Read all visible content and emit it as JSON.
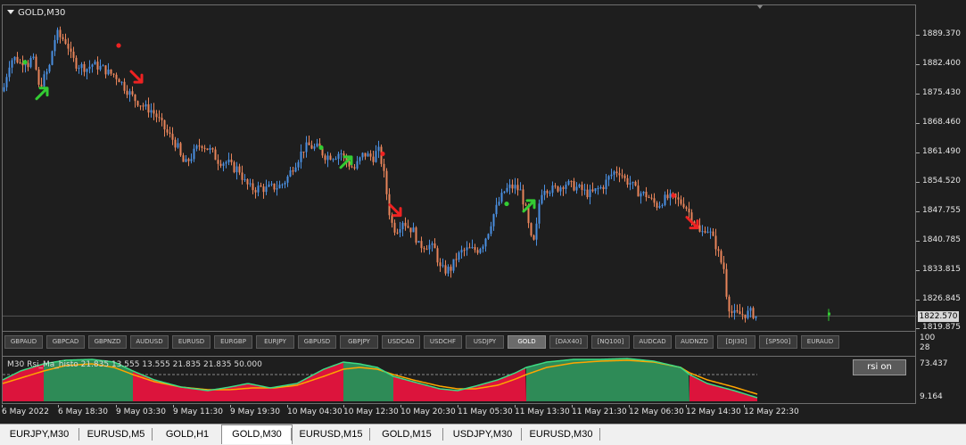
{
  "window": {
    "title": "GOLD,M30"
  },
  "price_axis": [
    "1889.370",
    "1882.400",
    "1875.430",
    "1868.460",
    "1861.490",
    "1854.520",
    "1847.755",
    "1840.785",
    "1833.815",
    "1826.845",
    "1819.875"
  ],
  "current_price": "1822.570",
  "symbols": [
    "GBPAUD",
    "GBPCAD",
    "GBPNZD",
    "AUDUSD",
    "EURUSD",
    "EURGBP",
    "EURJPY",
    "GBPUSD",
    "GBPJPY",
    "USDCAD",
    "USDCHF",
    "USDJPY",
    "GOLD",
    "[DAX40]",
    "[NQ100]",
    "AUDCAD",
    "AUDNZD",
    "[DJI30]",
    "[SP500]",
    "EURAUD"
  ],
  "active_symbol": "GOLD",
  "symbol_axis": [
    "100",
    "28"
  ],
  "indicator": {
    "title": "M30 Rsi_Ma_histo 21.835 13.555 13.555 21.835 21.835 50.000",
    "axis": [
      "73.437",
      "9.164"
    ],
    "button_label": "rsi on"
  },
  "time_axis": [
    "6 May 2022",
    "6 May 18:30",
    "9 May 03:30",
    "9 May 11:30",
    "9 May 19:30",
    "10 May 04:30",
    "10 May 12:30",
    "10 May 20:30",
    "11 May 05:30",
    "11 May 13:30",
    "11 May 21:30",
    "12 May 06:30",
    "12 May 14:30",
    "12 May 22:30"
  ],
  "tabs": [
    "EURJPY,M30",
    "EURUSD,M5",
    "GOLD,H1",
    "GOLD,M30",
    "EURUSD,M15",
    "GOLD,M15",
    "USDJPY,M30",
    "EURUSD,M30"
  ],
  "active_tab": "GOLD,M30",
  "colors": {
    "background": "#1e1e1e",
    "bull": "#4a8fe0",
    "bear": "#e8845a",
    "up_signal": "#33cc33",
    "down_signal": "#ee2222",
    "hist_green": "#2e8b57",
    "hist_red": "#dc143c",
    "rsi_line": "#3ddc84",
    "ma_line": "#ffa500"
  },
  "chart_data": {
    "type": "candlestick",
    "symbol": "GOLD",
    "timeframe": "M30",
    "ylim": [
      1819.875,
      1892.0
    ],
    "close_path": [
      [
        0,
        1876.5
      ],
      [
        4,
        1880.5
      ],
      [
        8,
        1884.0
      ],
      [
        14,
        1884.5
      ],
      [
        20,
        1883.0
      ],
      [
        24,
        1884.5
      ],
      [
        28,
        1883.0
      ],
      [
        32,
        1884.5
      ],
      [
        36,
        1883.0
      ],
      [
        40,
        1877.5
      ],
      [
        44,
        1879.0
      ],
      [
        48,
        1880.5
      ],
      [
        52,
        1882.5
      ],
      [
        56,
        1887.5
      ],
      [
        60,
        1890.5
      ],
      [
        64,
        1889.5
      ],
      [
        68,
        1889.0
      ],
      [
        72,
        1888.0
      ],
      [
        76,
        1885.0
      ],
      [
        82,
        1883.0
      ],
      [
        88,
        1882.5
      ],
      [
        94,
        1882.0
      ],
      [
        100,
        1883.0
      ],
      [
        106,
        1882.5
      ],
      [
        112,
        1882.0
      ],
      [
        118,
        1881.0
      ],
      [
        124,
        1880.5
      ],
      [
        130,
        1879.5
      ],
      [
        136,
        1877.5
      ],
      [
        142,
        1876.0
      ],
      [
        148,
        1874.5
      ],
      [
        154,
        1873.5
      ],
      [
        160,
        1872.5
      ],
      [
        166,
        1872.0
      ],
      [
        172,
        1870.5
      ],
      [
        178,
        1868.5
      ],
      [
        184,
        1866.5
      ],
      [
        190,
        1865.0
      ],
      [
        196,
        1863.0
      ],
      [
        200,
        1860.0
      ],
      [
        204,
        1859.0
      ],
      [
        210,
        1860.5
      ],
      [
        216,
        1862.5
      ],
      [
        222,
        1864.0
      ],
      [
        228,
        1863.0
      ],
      [
        234,
        1862.0
      ],
      [
        240,
        1860.0
      ],
      [
        246,
        1859.5
      ],
      [
        252,
        1859.5
      ],
      [
        258,
        1858.0
      ],
      [
        264,
        1858.0
      ],
      [
        270,
        1855.0
      ],
      [
        276,
        1853.5
      ],
      [
        282,
        1853.0
      ],
      [
        288,
        1853.5
      ],
      [
        294,
        1853.0
      ],
      [
        300,
        1853.5
      ],
      [
        306,
        1853.5
      ],
      [
        312,
        1854.0
      ],
      [
        318,
        1855.5
      ],
      [
        324,
        1858.0
      ],
      [
        330,
        1860.0
      ],
      [
        336,
        1862.5
      ],
      [
        342,
        1863.5
      ],
      [
        348,
        1863.0
      ],
      [
        354,
        1863.0
      ],
      [
        360,
        1861.0
      ],
      [
        366,
        1861.0
      ],
      [
        372,
        1861.0
      ],
      [
        378,
        1862.0
      ],
      [
        384,
        1860.0
      ],
      [
        390,
        1858.5
      ],
      [
        394,
        1858.0
      ],
      [
        398,
        1859.5
      ],
      [
        404,
        1861.5
      ],
      [
        410,
        1861.0
      ],
      [
        416,
        1860.5
      ],
      [
        420,
        1863.0
      ],
      [
        426,
        1858.0
      ],
      [
        430,
        1852.0
      ],
      [
        434,
        1846.0
      ],
      [
        438,
        1843.5
      ],
      [
        442,
        1843.5
      ],
      [
        448,
        1845.5
      ],
      [
        454,
        1844.0
      ],
      [
        460,
        1843.0
      ],
      [
        466,
        1839.5
      ],
      [
        472,
        1839.5
      ],
      [
        478,
        1839.5
      ],
      [
        484,
        1838.5
      ],
      [
        490,
        1834.0
      ],
      [
        496,
        1833.5
      ],
      [
        502,
        1834.0
      ],
      [
        508,
        1836.5
      ],
      [
        514,
        1838.0
      ],
      [
        520,
        1838.5
      ],
      [
        526,
        1838.5
      ],
      [
        532,
        1838.5
      ],
      [
        538,
        1840.0
      ],
      [
        544,
        1843.0
      ],
      [
        550,
        1847.0
      ],
      [
        556,
        1850.0
      ],
      [
        562,
        1852.5
      ],
      [
        568,
        1853.5
      ],
      [
        574,
        1853.5
      ],
      [
        580,
        1852.5
      ],
      [
        586,
        1848.0
      ],
      [
        590,
        1843.0
      ],
      [
        594,
        1839.0
      ],
      [
        598,
        1844.0
      ],
      [
        602,
        1851.5
      ],
      [
        606,
        1853.5
      ],
      [
        612,
        1853.0
      ],
      [
        618,
        1853.0
      ],
      [
        624,
        1853.5
      ],
      [
        630,
        1854.5
      ],
      [
        636,
        1854.0
      ],
      [
        642,
        1853.5
      ],
      [
        648,
        1853.0
      ],
      [
        654,
        1852.0
      ],
      [
        660,
        1852.0
      ],
      [
        666,
        1853.0
      ],
      [
        672,
        1853.5
      ],
      [
        678,
        1855.5
      ],
      [
        684,
        1857.0
      ],
      [
        690,
        1857.5
      ],
      [
        694,
        1856.5
      ],
      [
        698,
        1855.0
      ],
      [
        704,
        1854.5
      ],
      [
        710,
        1852.5
      ],
      [
        716,
        1852.0
      ],
      [
        722,
        1851.5
      ],
      [
        728,
        1850.0
      ],
      [
        734,
        1849.0
      ],
      [
        740,
        1850.5
      ],
      [
        746,
        1851.0
      ],
      [
        752,
        1851.0
      ],
      [
        758,
        1850.0
      ],
      [
        764,
        1849.5
      ],
      [
        770,
        1847.0
      ],
      [
        776,
        1845.0
      ],
      [
        782,
        1842.0
      ],
      [
        788,
        1844.0
      ],
      [
        794,
        1842.0
      ],
      [
        800,
        1839.0
      ],
      [
        804,
        1836.0
      ],
      [
        808,
        1834.0
      ],
      [
        812,
        1826.0
      ],
      [
        816,
        1823.5
      ],
      [
        820,
        1823.0
      ],
      [
        826,
        1823.0
      ],
      [
        832,
        1823.0
      ],
      [
        838,
        1823.5
      ],
      [
        844,
        1822.5
      ]
    ],
    "up_signals": [
      [
        44,
        1876.0
      ],
      [
        385,
        1859.5
      ],
      [
        590,
        1849.0
      ]
    ],
    "down_signals": [
      [
        150,
        1880.0
      ],
      [
        440,
        1848.0
      ],
      [
        773,
        1845.0
      ]
    ],
    "dots_green": [
      [
        25,
        1883.5
      ],
      [
        357,
        1863.0
      ],
      [
        565,
        1849.5
      ]
    ],
    "dots_red": [
      [
        130,
        1887.5
      ],
      [
        426,
        1861.5
      ],
      [
        752,
        1851.5
      ]
    ],
    "current_tick_x": 926
  }
}
